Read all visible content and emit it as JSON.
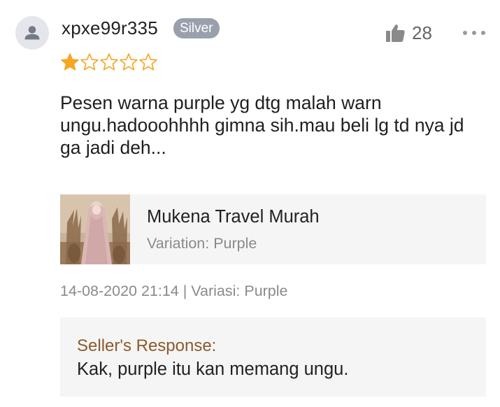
{
  "review": {
    "username": "xpxe99r335",
    "badge": "Silver",
    "like_count": "28",
    "rating": 1,
    "rating_max": 5,
    "comment": "Pesen warna purple yg dtg malah warn ungu.hadooohhhh gimna sih.mau beli lg td nya jd ga jadi deh...",
    "product": {
      "name": "Mukena Travel Murah",
      "variation": "Variation: Purple"
    },
    "meta": "14-08-2020 21:14 | Variasi: Purple",
    "seller_response": {
      "title": "Seller's Response:",
      "text": "Kak, purple itu kan memang ungu."
    }
  },
  "icons": {
    "avatar": "user-icon",
    "like": "thumbs-up-icon",
    "more": "more-icon",
    "star_filled": "star-filled-icon",
    "star_empty": "star-outline-icon"
  },
  "colors": {
    "badge_bg": "#9aa0ab",
    "star": "#f5a623",
    "seller_title": "#8b5a2b",
    "muted": "#8a8a8a",
    "panel_bg": "#f5f5f5"
  }
}
